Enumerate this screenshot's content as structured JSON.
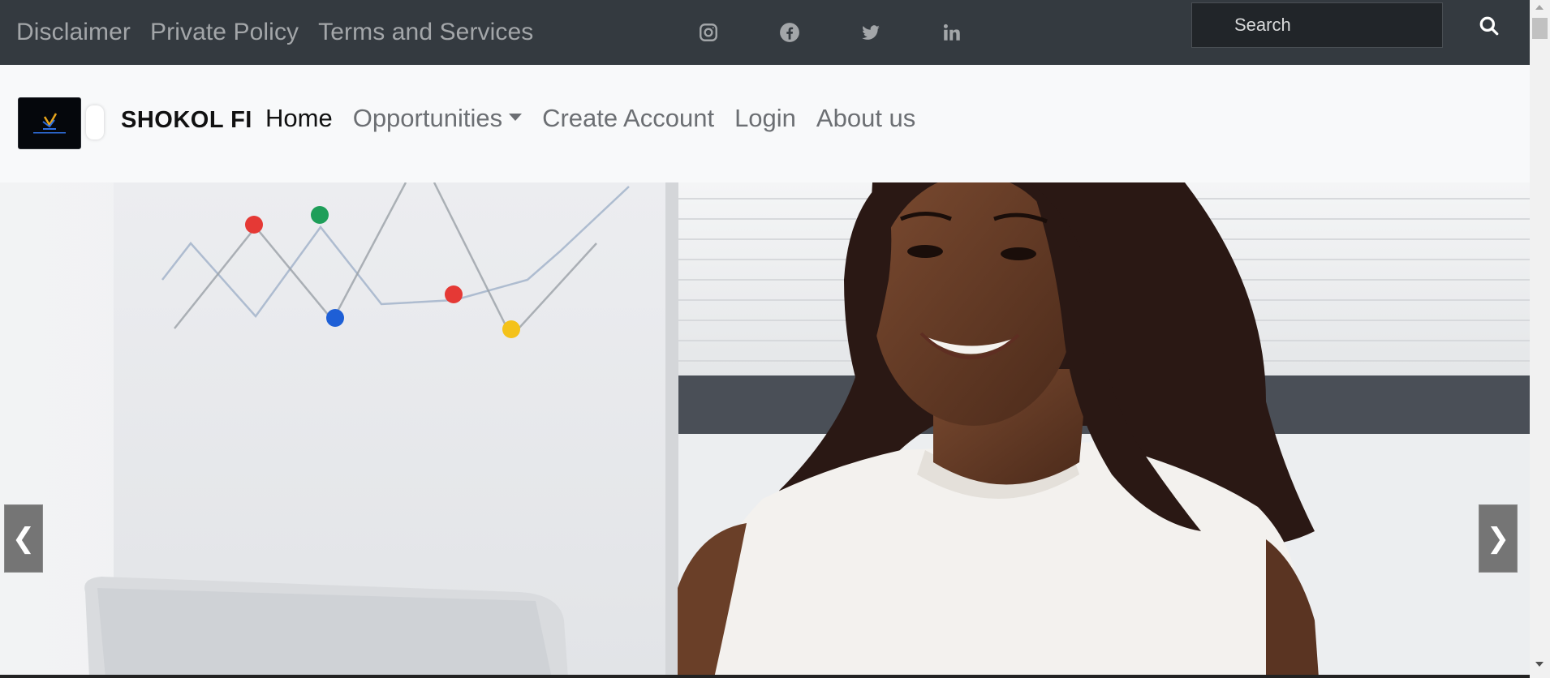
{
  "topbar": {
    "links": [
      "Disclaimer",
      "Private Policy",
      "Terms and Services"
    ],
    "socials": [
      "instagram-icon",
      "facebook-icon",
      "twitter-icon",
      "linkedin-icon"
    ],
    "search_placeholder": "Search"
  },
  "navbar": {
    "brand": "SHOKOL FI",
    "items": [
      {
        "label": "Home",
        "active": true
      },
      {
        "label": "Opportunities",
        "dropdown": true
      },
      {
        "label": "Create Account"
      },
      {
        "label": "Login"
      },
      {
        "label": "About us"
      }
    ]
  },
  "carousel": {
    "prev_glyph": "❮",
    "next_glyph": "❯"
  },
  "colors": {
    "topbar_bg": "#343a40",
    "navbar_bg": "#f8f9fa",
    "link_muted": "#a3a6a9",
    "carousel_control": "#757575"
  }
}
